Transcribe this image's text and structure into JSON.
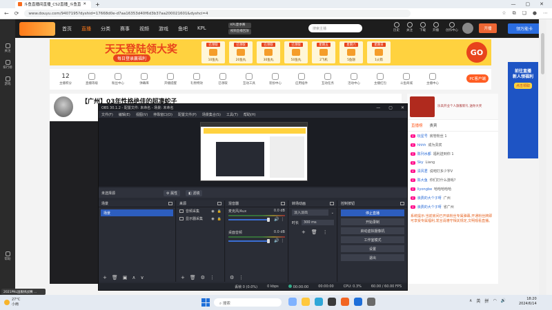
{
  "browser": {
    "tab_title": "斗鱼直播间直播_CS2直播_斗鱼直",
    "url": "www.douyu.com/9407195?dyshid=17668d0e-d7aa16353d40f6d3b37aa200021601&dyshci=4",
    "window_controls": [
      "—",
      "▢",
      "✕"
    ]
  },
  "sidebar": {
    "items": [
      {
        "label": "关注"
      },
      {
        "label": "排行榜"
      },
      {
        "label": "游戏"
      },
      {
        "label": "帮助"
      }
    ]
  },
  "site": {
    "nav": [
      "首页",
      "直播",
      "分类",
      "赛事",
      "视频",
      "游戏",
      "鱼吧",
      "KPL"
    ],
    "nav_active_index": 1,
    "header_badge": "KPL夏季赛",
    "header_badge2": "视频直播回放",
    "search_placeholder": "搜索主播",
    "header_icons": [
      "历史",
      "关注",
      "下载",
      "开播",
      "创作中心"
    ],
    "open_label": "开播",
    "blue_banner": "领万能卡"
  },
  "banner": {
    "title": "天天登陆领大奖",
    "subtitle": "每日登录赢福利",
    "days": [
      {
        "head": "已领取",
        "foot": "10鱼丸"
      },
      {
        "head": "已领取",
        "foot": "20鱼丸"
      },
      {
        "head": "已领取",
        "foot": "30鱼丸"
      },
      {
        "head": "已领取",
        "foot": "50鱼丸"
      },
      {
        "head": "星期五",
        "foot": "2飞机"
      },
      {
        "head": "星期六",
        "foot": "5鱼翅"
      },
      {
        "head": "星期日",
        "foot": "1火箭"
      }
    ],
    "go_label": "GO"
  },
  "categories": {
    "first_num": "12",
    "items": [
      "主播积分",
      "直播等级",
      "粉丝中心",
      "弹幕库",
      "开播提醒",
      "礼物特效",
      "已领取",
      "互动工具",
      "装扮中心",
      "应用插件",
      "互动任务",
      "活动中心",
      "主播红包",
      "斗鱼商城",
      "主播中心",
      "主播一起玩",
      "更多"
    ],
    "pc_button": "PC客户端"
  },
  "streamer": {
    "title": "【广州】03年性格绝佳的超凄蛇子"
  },
  "chat": {
    "gift_text": "乐高开业个人旗舰新礼 送你大奖",
    "tabs": [
      "直播榜",
      "贵宾"
    ],
    "lines": [
      {
        "user": "玩星号",
        "msg": "房管粉丝 1"
      },
      {
        "user": "hhhh",
        "msg": "成为贵宾"
      },
      {
        "user": "陈列水都",
        "msg": "福利送到你 1"
      },
      {
        "user": "Sky",
        "msg": "Liang"
      },
      {
        "user": "清风君",
        "msg": "说吧打多少字V"
      },
      {
        "user": "陈大鱼",
        "msg": "你们打什么游戏?"
      },
      {
        "user": "liyongbe",
        "msg": "哈哈哈哈哈"
      },
      {
        "user": "浪费的大个子呀",
        "msg": "广州"
      },
      {
        "user": "浪费的大个子呀",
        "msg": "省广州"
      }
    ],
    "notice": "系统提示:当前房间已开启粉丝专属弹幕,开通粉丝牌即可享受专属福利,发言请遵守相关规定,文明观看直播。"
  },
  "farright": {
    "title": "前往直播\n新人领福利",
    "btn": "点击领取"
  },
  "obs": {
    "title": "OBS 30.1.2 - 配置文件: 未命名 - 场景: 未命名",
    "menu": [
      "文件(F)",
      "编辑(E)",
      "视图(V)",
      "停靠窗口(D)",
      "配置文件(P)",
      "场景集合(S)",
      "工具(T)",
      "帮助(H)"
    ],
    "no_source": "未选择源",
    "props_btn": "属性",
    "filters_btn": "滤镜",
    "docks": {
      "scenes": {
        "title": "场景",
        "items": [
          "场景"
        ]
      },
      "sources": {
        "title": "来源",
        "items": [
          {
            "name": "音频采集"
          },
          {
            "name": "显示器采集"
          }
        ]
      },
      "mixer": {
        "title": "混音器",
        "channels": [
          {
            "name": "麦克风/Aux",
            "db": "0.0 dB"
          },
          {
            "name": "桌面音频",
            "db": "0.0 dB"
          }
        ]
      },
      "transitions": {
        "title": "转场动画",
        "type": "淡入淡出",
        "duration_label": "时长",
        "duration": "300 ms"
      },
      "controls": {
        "title": "控制按钮",
        "buttons": [
          "停止直播",
          "开始录制",
          "启动虚拟摄像机",
          "工作室模式",
          "设置",
          "退出"
        ]
      }
    },
    "status": {
      "dropped": "丢帧 0 (0.0%)",
      "bitrate": "0 kbps",
      "live_time": "00:00:00",
      "rec_time": "00:00:00",
      "cpu": "CPU: 0.3%",
      "fps": "60.00 / 60.00 FPS"
    }
  },
  "notification": "2021PNL国服挑战赛 ...",
  "taskbar": {
    "weather_temp": "27°C",
    "weather_desc": "小雨",
    "search_placeholder": "搜索",
    "tray_lang": "英",
    "tray_ime": "拼",
    "time": "18:20",
    "date": "2024/6/14"
  }
}
